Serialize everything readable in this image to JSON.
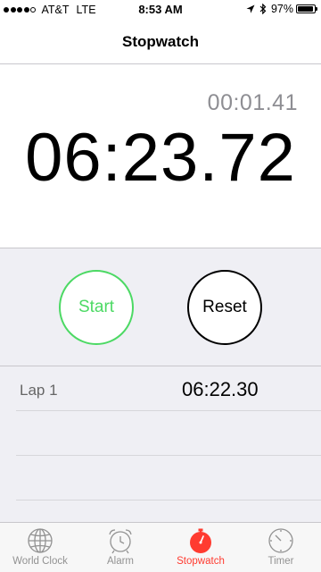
{
  "status_bar": {
    "carrier": "AT&T",
    "network": "LTE",
    "time": "8:53 AM",
    "battery": "97%",
    "battery_level": 0.97,
    "signal_bars": 4,
    "signal_max": 5
  },
  "nav": {
    "title": "Stopwatch"
  },
  "display": {
    "lap_time": "00:01.41",
    "main_time": "06:23.72"
  },
  "controls": {
    "start_label": "Start",
    "reset_label": "Reset"
  },
  "laps": [
    {
      "label": "Lap 1",
      "time": "06:22.30"
    }
  ],
  "tabs": [
    {
      "label": "World Clock",
      "icon": "globe-icon"
    },
    {
      "label": "Alarm",
      "icon": "alarm-clock-icon"
    },
    {
      "label": "Stopwatch",
      "icon": "stopwatch-icon",
      "active": true
    },
    {
      "label": "Timer",
      "icon": "timer-icon"
    }
  ],
  "colors": {
    "accent": "#ff3b30",
    "start": "#4cd964",
    "background": "#efeff4"
  }
}
